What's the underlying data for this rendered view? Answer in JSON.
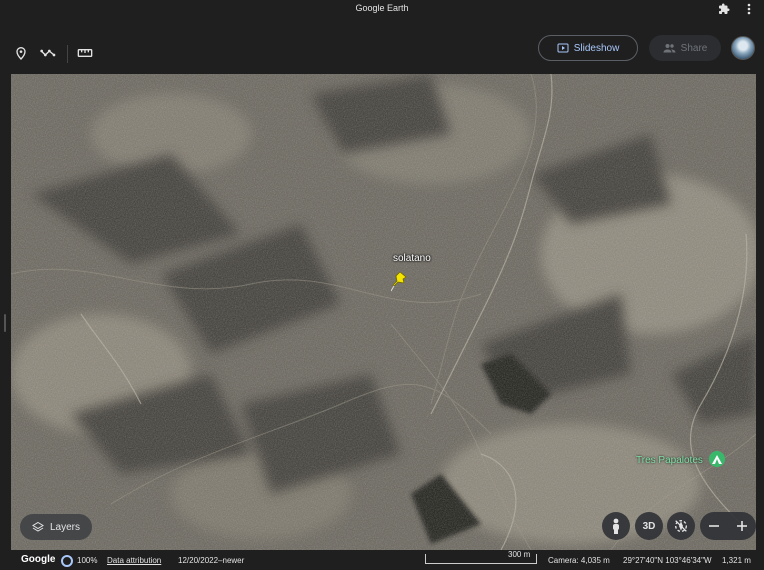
{
  "window": {
    "title": "Google Earth"
  },
  "toolbar": {
    "tools": [
      "add-placemark-icon",
      "draw-path-icon",
      "measure-icon"
    ],
    "slideshow_label": "Slideshow",
    "share_label": "Share"
  },
  "map": {
    "placemark": {
      "label": "solatano",
      "color": "#f5e400"
    },
    "poi": {
      "label": "Tres Papalotes",
      "color": "#39b86b"
    }
  },
  "controls": {
    "layers_label": "Layers",
    "view_3d_label": "3D"
  },
  "status": {
    "logo": "Google",
    "load_percent": "100%",
    "attribution": "Data attribution",
    "imagery_date": "12/20/2022–newer",
    "scale": "300 m",
    "camera": "Camera: 4,035 m",
    "coordinates": "29°27'40\"N 103°46'34\"W",
    "elevation": "1,321 m"
  }
}
